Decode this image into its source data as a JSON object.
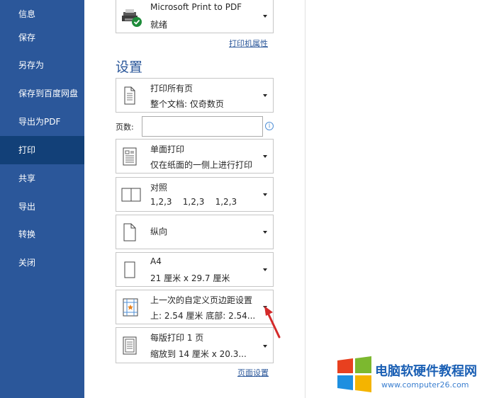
{
  "sidebar": {
    "items": [
      {
        "label": "信息"
      },
      {
        "label": "保存"
      },
      {
        "label": "另存为"
      },
      {
        "label": "保存到百度网盘"
      },
      {
        "label": "导出为PDF"
      },
      {
        "label": "打印",
        "active": true
      },
      {
        "label": "共享"
      },
      {
        "label": "导出"
      },
      {
        "label": "转换"
      },
      {
        "label": "关闭"
      }
    ]
  },
  "printer": {
    "name": "Microsoft Print to PDF",
    "status": "就绪",
    "properties_link": "打印机属性"
  },
  "settings": {
    "title": "设置",
    "print_range": {
      "main": "打印所有页",
      "sub": "整个文档: 仅奇数页"
    },
    "pages_label": "页数:",
    "pages_value": "",
    "info_glyph": "i",
    "sides": {
      "main": "单面打印",
      "sub": "仅在纸面的一侧上进行打印"
    },
    "collate": {
      "main": "对照",
      "sub": "1,2,3    1,2,3    1,2,3"
    },
    "orientation": {
      "main": "纵向"
    },
    "paper": {
      "main": "A4",
      "sub": "21 厘米 x 29.7 厘米"
    },
    "margins": {
      "main": "上一次的自定义页边距设置",
      "sub": "上: 2.54 厘米 底部: 2.54..."
    },
    "pages_per_sheet": {
      "main": "每版打印 1 页",
      "sub": "缩放到 14 厘米 x 20.3..."
    },
    "page_setup_link": "页面设置"
  },
  "watermark": {
    "title": "电脑软硬件教程网",
    "url": "www.computer26.com"
  },
  "colors": {
    "sidebar_bg": "#2b579a",
    "sidebar_active": "#124078",
    "accent": "#2b579a"
  }
}
